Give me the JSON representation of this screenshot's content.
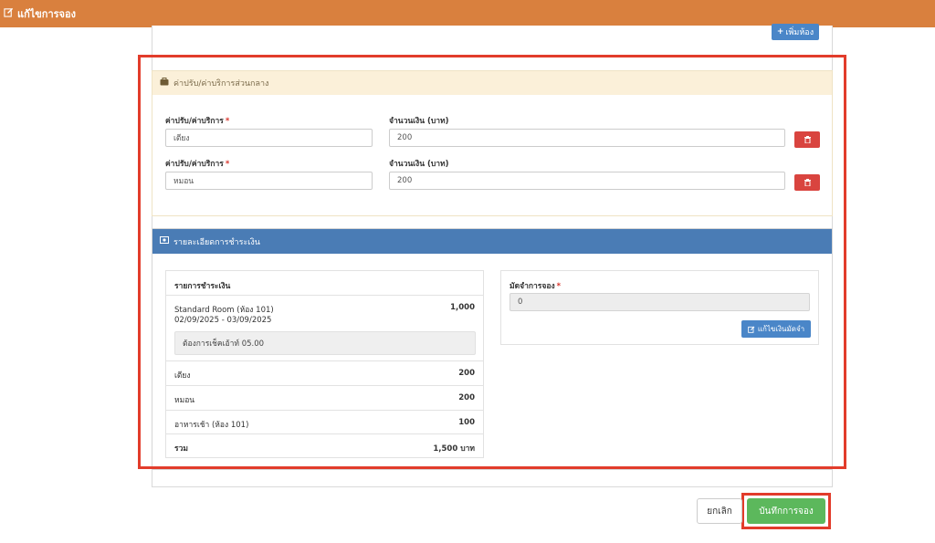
{
  "header": {
    "title": "แก้ไขการจอง",
    "icon": "edit-icon"
  },
  "top": {
    "add_room_label": "เพิ่มห้อง"
  },
  "fees": {
    "section_title": "ค่าปรับ/ค่าบริการส่วนกลาง",
    "rows": [
      {
        "name_label": "ค่าปรับ/ค่าบริการ",
        "required": "*",
        "name_value": "เตียง",
        "amount_label": "จำนวนเงิน (บาท)",
        "amount_value": "200"
      },
      {
        "name_label": "ค่าปรับ/ค่าบริการ",
        "required": "*",
        "name_value": "หมอน",
        "amount_label": "จำนวนเงิน (บาท)",
        "amount_value": "200"
      }
    ]
  },
  "payment": {
    "section_title": "รายละเอียดการชำระเงิน",
    "items_header": "รายการชำระเงิน",
    "room": {
      "name": "Standard Room (ห้อง 101)",
      "dates": "02/09/2025 - 03/09/2025",
      "amount": "1,000",
      "note": "ต้องการเช็คเอ้าท์ 05.00"
    },
    "lines": [
      {
        "label": "เตียง",
        "amount": "200"
      },
      {
        "label": "หมอน",
        "amount": "200"
      },
      {
        "label": "อาหารเช้า (ห้อง 101)",
        "amount": "100"
      }
    ],
    "total": {
      "label": "รวม",
      "amount": "1,500 บาท"
    },
    "deposit": {
      "label": "มัดจำการจอง",
      "required": "*",
      "value": "0",
      "edit_label": "แก้ไขเงินมัดจำ"
    }
  },
  "footer": {
    "cancel_label": "ยกเลิก",
    "save_label": "บันทึกการจอง"
  },
  "colors": {
    "header": "#d9803e",
    "fee_header": "#fbf0d9",
    "pay_header": "#4a7cb5",
    "primary": "#4a86c8",
    "danger": "#d9443f",
    "success": "#5cb85c",
    "highlight": "#e23c2b"
  }
}
